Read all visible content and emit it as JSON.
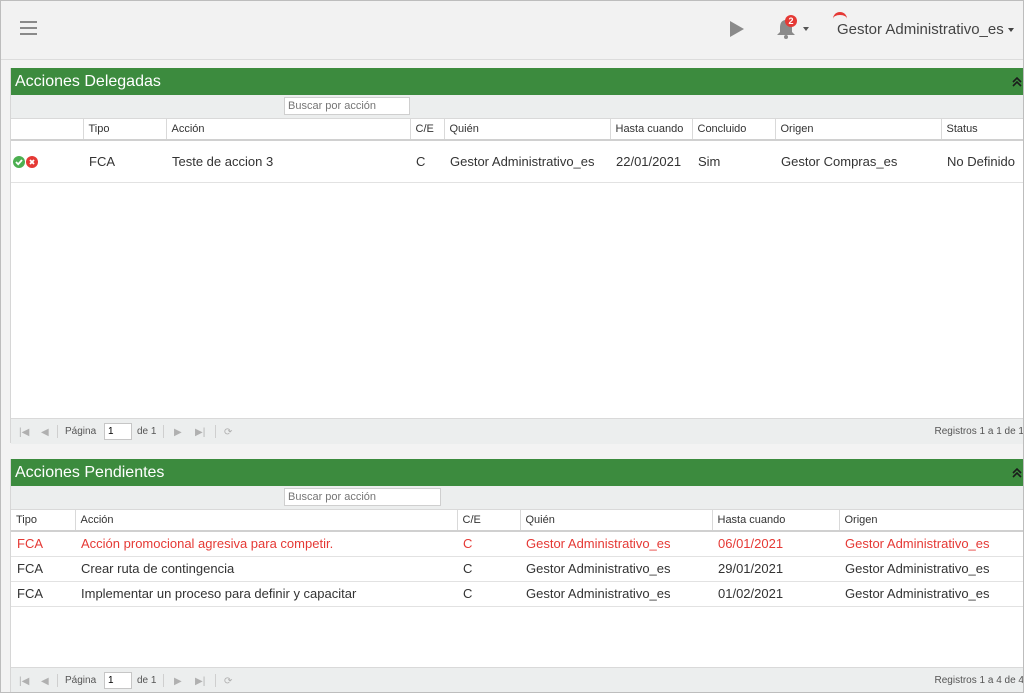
{
  "header": {
    "notification_count": "2",
    "user_name": "Gestor Administrativo_es"
  },
  "delegadas": {
    "title": "Acciones Delegadas",
    "search_placeholder": "Buscar por acción",
    "columns": [
      "Tipo",
      "Acción",
      "C/E",
      "Quién",
      "Hasta cuando",
      "Concluido",
      "Origen",
      "Status"
    ],
    "rows": [
      {
        "tipo": "FCA",
        "accion": "Teste de accion 3",
        "ce": "C",
        "quien": "Gestor Administrativo_es",
        "hasta": "22/01/2021",
        "concluido": "Sim",
        "origen": "Gestor Compras_es",
        "status": "No Definido"
      }
    ],
    "pager": {
      "page_label": "Página",
      "page_value": "1",
      "of_label": "de 1",
      "records": "Registros 1 a 1 de 1"
    }
  },
  "pendientes": {
    "title": "Acciones Pendientes",
    "search_placeholder": "Buscar por acción",
    "columns": [
      "Tipo",
      "Acción",
      "C/E",
      "Quién",
      "Hasta cuando",
      "Origen"
    ],
    "rows": [
      {
        "tipo": "FCA",
        "accion": "Acción promocional agresiva para competir.",
        "ce": "C",
        "quien": "Gestor Administrativo_es",
        "hasta": "06/01/2021",
        "origen": "Gestor Administrativo_es",
        "overdue": true
      },
      {
        "tipo": "FCA",
        "accion": "Crear ruta de contingencia",
        "ce": "C",
        "quien": "Gestor Administrativo_es",
        "hasta": "29/01/2021",
        "origen": "Gestor Administrativo_es",
        "overdue": false
      },
      {
        "tipo": "FCA",
        "accion": "Implementar un proceso para definir y capacitar",
        "ce": "C",
        "quien": "Gestor Administrativo_es",
        "hasta": "01/02/2021",
        "origen": "Gestor Administrativo_es",
        "overdue": false
      }
    ],
    "pager": {
      "page_label": "Página",
      "page_value": "1",
      "of_label": "de 1",
      "records": "Registros 1 a 4 de 4"
    }
  },
  "colors": {
    "header_green": "#3c8b3e",
    "overdue_red": "#e53935",
    "approve_green": "#4caf50",
    "reject_red": "#e53935"
  }
}
